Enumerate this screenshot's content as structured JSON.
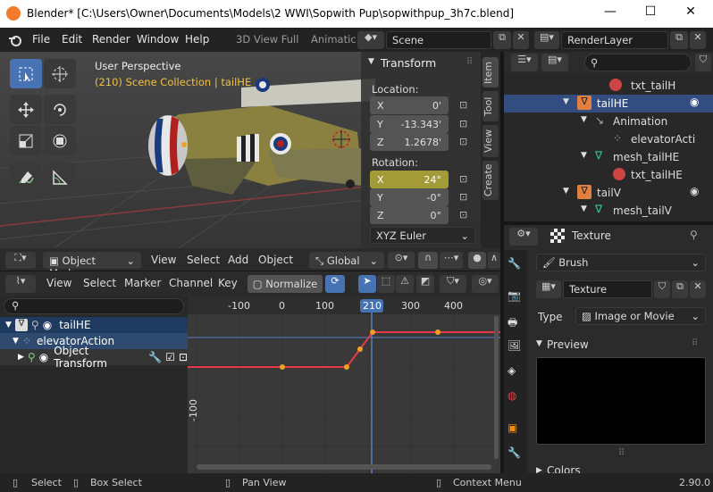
{
  "titlebar": {
    "title": "Blender* [C:\\Users\\Owner\\Documents\\Models\\2 WWI\\Sopwith Pup\\sopwithpup_3h7c.blend]",
    "minimize": "—",
    "maximize": "☐",
    "close": "✕"
  },
  "menu": {
    "items": [
      "File",
      "Edit",
      "Render",
      "Window",
      "Help"
    ],
    "workspaces": [
      "3D View Full",
      "Animatic"
    ],
    "scene": "Scene",
    "renderlayer": "RenderLayer"
  },
  "viewport": {
    "perspective": "User Perspective",
    "collection": "(210) Scene Collection | tailHE",
    "transform_title": "Transform",
    "location_label": "Location:",
    "location": [
      {
        "axis": "X",
        "value": "0'"
      },
      {
        "axis": "Y",
        "value": "-13.343'"
      },
      {
        "axis": "Z",
        "value": "1.2678'"
      }
    ],
    "rotation_label": "Rotation:",
    "rotation": [
      {
        "axis": "X",
        "value": "24°"
      },
      {
        "axis": "Y",
        "value": "-0°"
      },
      {
        "axis": "Z",
        "value": "0°"
      }
    ],
    "rotation_mode": "XYZ Euler",
    "side_tabs": [
      "Item",
      "Tool",
      "View",
      "Create"
    ]
  },
  "viewport_header": {
    "mode": "Object Mode",
    "menus": [
      "View",
      "Select",
      "Add",
      "Object"
    ],
    "orientation": "Global"
  },
  "graph_header": {
    "menus": [
      "View",
      "Select",
      "Marker",
      "Channel",
      "Key"
    ],
    "normalize": "Normalize"
  },
  "channels": {
    "object": "tailHE",
    "action": "elevatorAction",
    "group": "Object Transform"
  },
  "graph": {
    "current_frame": "210",
    "x_ticks": [
      "-100",
      "0",
      "100",
      "200",
      "300",
      "400"
    ],
    "y_tick": "-100"
  },
  "outliner": {
    "rows": [
      {
        "label": "txt_tailH",
        "kind": "texture"
      },
      {
        "label": "tailHE",
        "kind": "object"
      },
      {
        "label": "Animation",
        "kind": "anim"
      },
      {
        "label": "elevatorActi",
        "kind": "action"
      },
      {
        "label": "mesh_tailHE",
        "kind": "mesh"
      },
      {
        "label": "txt_tailHE",
        "kind": "texture"
      },
      {
        "label": "tailV",
        "kind": "object"
      },
      {
        "label": "mesh_tailV",
        "kind": "mesh"
      }
    ]
  },
  "properties": {
    "context": "Texture",
    "brush": "Brush",
    "texture_name": "Texture",
    "type_label": "Type",
    "type_value": "Image or Movie",
    "preview_label": "Preview",
    "colors_label": "Colors"
  },
  "statusbar": {
    "select": "Select",
    "box_select": "Box Select",
    "pan": "Pan View",
    "context_menu": "Context Menu",
    "version": "2.90.0"
  },
  "colors": {
    "accent": "#4772b3",
    "highlight": "#334d80",
    "curve": "#e8394a",
    "keyframe": "#f0a020",
    "frame_line": "#5680c2"
  }
}
